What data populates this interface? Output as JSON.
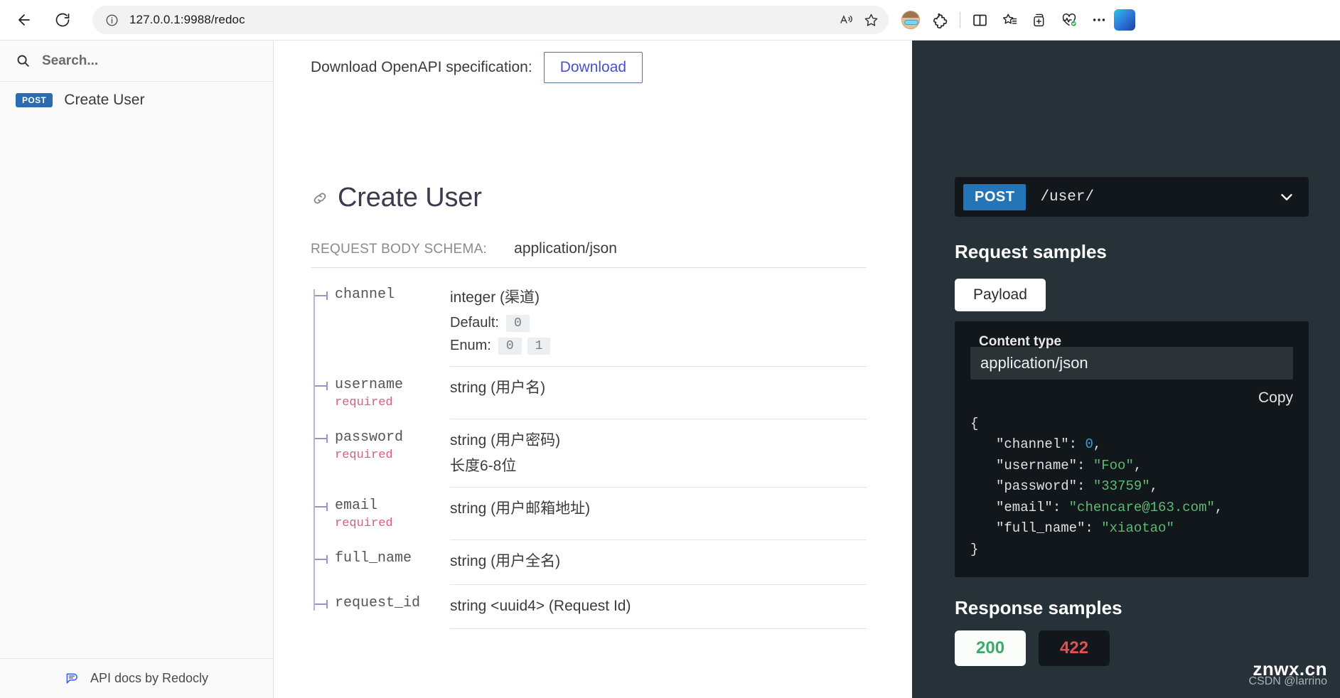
{
  "browser": {
    "url": "127.0.0.1:9988/redoc",
    "back_label": "Back",
    "reload_label": "Refresh",
    "site_info_label": "View site information",
    "read_aloud_label": "Read aloud",
    "favorite_label": "Add this page to favorites",
    "profile_label": "Profile",
    "extensions_label": "Extensions",
    "split_screen_label": "Split screen",
    "collections_label": "Favorites",
    "add_tab_label": "Add to collections",
    "browser_essentials_label": "Browser essentials",
    "settings_label": "Settings and more",
    "copilot_label": "Copilot"
  },
  "sidebar": {
    "search_placeholder": "Search...",
    "items": [
      {
        "method": "POST",
        "label": "Create User"
      }
    ],
    "footer_text": "API docs by Redocly"
  },
  "doc": {
    "download_label": "Download OpenAPI specification:",
    "download_button": "Download",
    "operation_title": "Create User",
    "schema_label": "REQUEST BODY SCHEMA:",
    "schema_value": "application/json",
    "properties": [
      {
        "name": "channel",
        "required": "",
        "type": "integer (渠道)",
        "note": "",
        "meta": [
          {
            "label": "Default:",
            "values": [
              "0"
            ]
          },
          {
            "label": "Enum:",
            "values": [
              "0",
              "1"
            ]
          }
        ]
      },
      {
        "name": "username",
        "required": "required",
        "type": "string (用户名)",
        "note": "",
        "meta": []
      },
      {
        "name": "password",
        "required": "required",
        "type": "string (用户密码)",
        "note": "长度6-8位",
        "meta": []
      },
      {
        "name": "email",
        "required": "required",
        "type": "string (用户邮箱地址)",
        "note": "",
        "meta": []
      },
      {
        "name": "full_name",
        "required": "",
        "type": "string (用户全名)",
        "note": "",
        "meta": []
      },
      {
        "name": "request_id",
        "required": "",
        "type": "string <uuid4> (Request Id)",
        "note": "",
        "meta": []
      }
    ]
  },
  "panel": {
    "endpoint_method": "POST",
    "endpoint_path": "/user/",
    "request_heading": "Request samples",
    "request_tabs": [
      "Payload"
    ],
    "content_type_label": "Content type",
    "content_type_value": "application/json",
    "copy_label": "Copy",
    "sample_lines": [
      {
        "indent": 0,
        "tokens": [
          {
            "t": "{",
            "c": "p"
          }
        ]
      },
      {
        "indent": 1,
        "tokens": [
          {
            "t": "\"channel\"",
            "c": "k"
          },
          {
            "t": ": ",
            "c": "p"
          },
          {
            "t": "0",
            "c": "n"
          },
          {
            "t": ",",
            "c": "p"
          }
        ]
      },
      {
        "indent": 1,
        "tokens": [
          {
            "t": "\"username\"",
            "c": "k"
          },
          {
            "t": ": ",
            "c": "p"
          },
          {
            "t": "\"Foo\"",
            "c": "s"
          },
          {
            "t": ",",
            "c": "p"
          }
        ]
      },
      {
        "indent": 1,
        "tokens": [
          {
            "t": "\"password\"",
            "c": "k"
          },
          {
            "t": ": ",
            "c": "p"
          },
          {
            "t": "\"33759\"",
            "c": "s"
          },
          {
            "t": ",",
            "c": "p"
          }
        ]
      },
      {
        "indent": 1,
        "tokens": [
          {
            "t": "\"email\"",
            "c": "k"
          },
          {
            "t": ": ",
            "c": "p"
          },
          {
            "t": "\"chencare@163.com\"",
            "c": "s"
          },
          {
            "t": ",",
            "c": "p"
          }
        ]
      },
      {
        "indent": 1,
        "tokens": [
          {
            "t": "\"full_name\"",
            "c": "k"
          },
          {
            "t": ": ",
            "c": "p"
          },
          {
            "t": "\"xiaotao\"",
            "c": "s"
          }
        ]
      },
      {
        "indent": 0,
        "tokens": [
          {
            "t": "}",
            "c": "p"
          }
        ]
      }
    ],
    "response_heading": "Response samples",
    "response_tabs": [
      {
        "code": "200",
        "state": "ok"
      },
      {
        "code": "422",
        "state": "err"
      }
    ]
  },
  "watermark": {
    "main": "znwx.cn",
    "sub": "CSDN @larrino"
  },
  "colors": {
    "method_badge": "#2b6cb0",
    "panel_bg": "#263238",
    "code_bg": "#11171a",
    "required": "#d9607c",
    "link": "#4a4fd0",
    "ok": "#3ea96b",
    "error": "#e05252"
  }
}
